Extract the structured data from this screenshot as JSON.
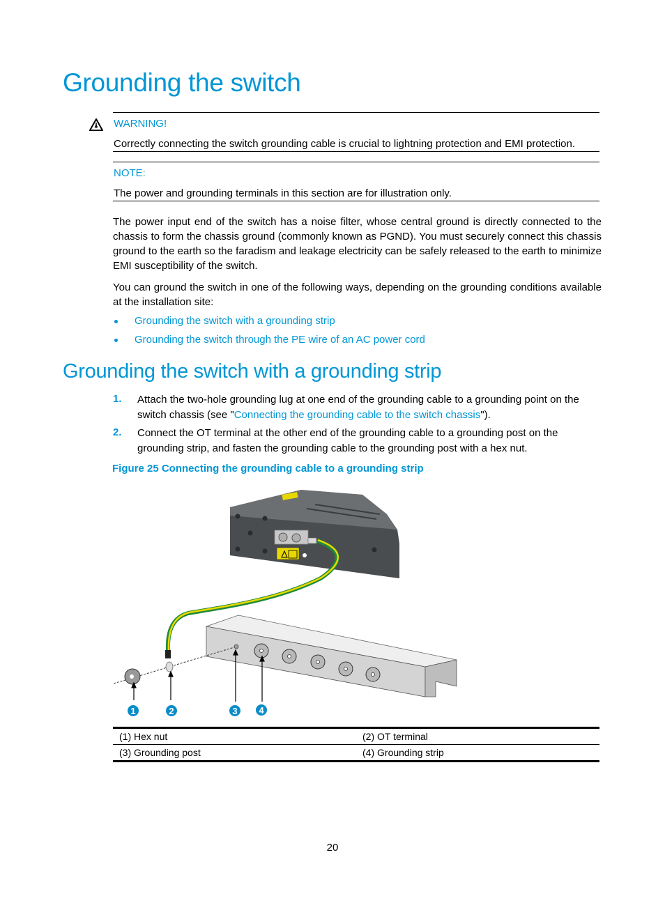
{
  "headings": {
    "title": "Grounding the switch",
    "section": "Grounding the switch with a grounding strip"
  },
  "warning": {
    "label": "WARNING!",
    "text": "Correctly connecting the switch grounding cable is crucial to lightning protection and EMI protection."
  },
  "note": {
    "label": "NOTE:",
    "text": "The power and grounding terminals in this section are for illustration only."
  },
  "paragraphs": [
    "The power input end of the switch has a noise filter, whose central ground is directly connected to the chassis to form the chassis ground (commonly known as PGND). You must securely connect this chassis ground to the earth so the faradism and leakage electricity can be safely released to the earth to minimize EMI susceptibility of the switch.",
    "You can ground the switch in one of the following ways, depending on the grounding conditions available at the installation site:"
  ],
  "bullets": [
    "Grounding the switch with a grounding strip",
    "Grounding the switch through the PE wire of an AC power cord"
  ],
  "steps": [
    {
      "num": "1.",
      "text_before": "Attach the two-hole grounding lug at one end of the grounding cable to a grounding point on the switch chassis (see \"",
      "link": "Connecting the grounding cable to the switch chassis",
      "text_after": "\")."
    },
    {
      "num": "2.",
      "text": "Connect the OT terminal at the other end of the grounding cable to a grounding post on the grounding strip, and fasten the grounding cable to the grounding post with a hex nut."
    }
  ],
  "figure": {
    "caption": "Figure 25 Connecting the grounding cable to a grounding strip",
    "callouts": [
      "1",
      "2",
      "3",
      "4"
    ],
    "legend": [
      [
        "(1) Hex nut",
        "(2) OT terminal"
      ],
      [
        "(3) Grounding post",
        "(4) Grounding strip"
      ]
    ],
    "colors": {
      "callout": "#0a8cc8",
      "chassis": "#4a4d50",
      "cable_green": "#1f8a3a",
      "cable_yellow": "#e8d800",
      "strip": "#d8d8d8"
    }
  },
  "footer": {
    "page_number": "20"
  }
}
